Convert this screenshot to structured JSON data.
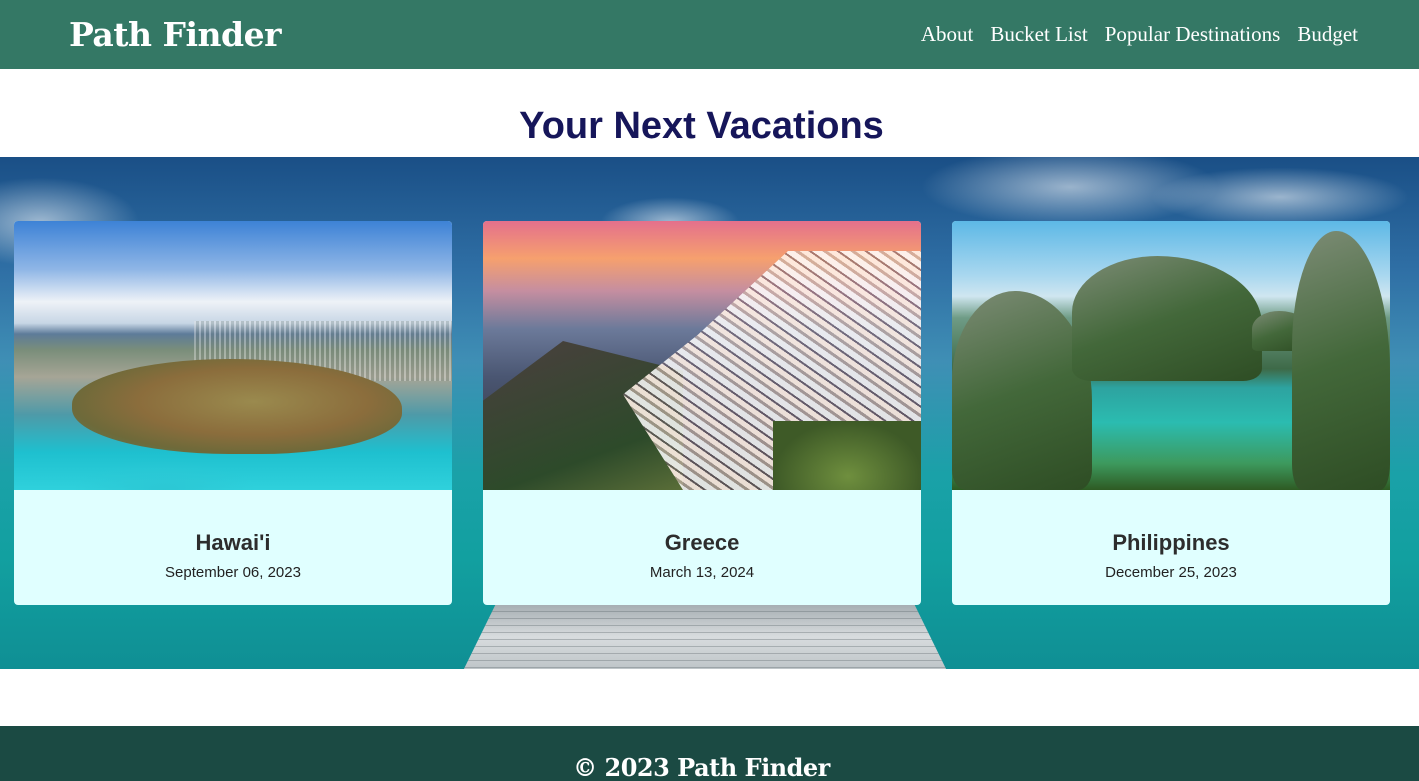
{
  "header": {
    "brand": "Path Finder",
    "nav": [
      {
        "label": "About"
      },
      {
        "label": "Bucket List"
      },
      {
        "label": "Popular Destinations"
      },
      {
        "label": "Budget"
      }
    ]
  },
  "main": {
    "title": "Your Next Vacations",
    "cards": [
      {
        "name": "Hawai'i",
        "date": "September 06, 2023"
      },
      {
        "name": "Greece",
        "date": "March 13, 2024"
      },
      {
        "name": "Philippines",
        "date": "December 25, 2023"
      }
    ]
  },
  "footer": {
    "text": "© 2023 Path Finder"
  },
  "colors": {
    "header_bg": "#347865",
    "footer_bg": "#1b4a43",
    "title": "#16165a",
    "card_bg": "#e0ffff"
  }
}
